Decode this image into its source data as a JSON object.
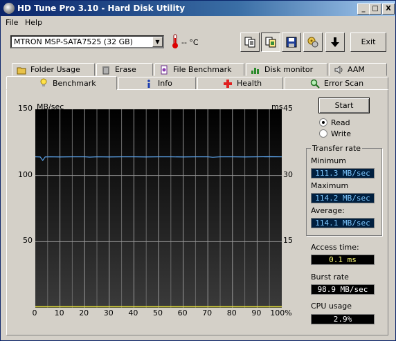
{
  "window": {
    "title": "HD Tune Pro 3.10 - Hard Disk Utility",
    "min": "_",
    "max": "□",
    "close": "X"
  },
  "menu": {
    "file": "File",
    "help": "Help"
  },
  "toolbar": {
    "drive": "MTRON MSP-SATA7525 (32 GB)",
    "temperature": "-- °C",
    "exit": "Exit",
    "icons": [
      "copy-text-icon",
      "copy-screenshot-icon",
      "save-icon",
      "options-icon",
      "download-arrow-icon"
    ]
  },
  "tabs_row1": [
    {
      "label": "Folder Usage",
      "icon": "folder-icon"
    },
    {
      "label": "Erase",
      "icon": "trash-icon"
    },
    {
      "label": "File Benchmark",
      "icon": "file-benchmark-icon"
    },
    {
      "label": "Disk monitor",
      "icon": "disk-monitor-icon"
    },
    {
      "label": "AAM",
      "icon": "speaker-icon"
    }
  ],
  "tabs_row2": [
    {
      "label": "Benchmark",
      "icon": "lightbulb-icon",
      "active": true
    },
    {
      "label": "Info",
      "icon": "info-icon"
    },
    {
      "label": "Health",
      "icon": "health-cross-icon"
    },
    {
      "label": "Error Scan",
      "icon": "magnifier-icon"
    }
  ],
  "controls": {
    "start": "Start",
    "read": "Read",
    "write": "Write",
    "mode_selected": "Read"
  },
  "transfer_rate": {
    "title": "Transfer rate",
    "minimum_label": "Minimum",
    "minimum": "111.3 MB/sec",
    "maximum_label": "Maximum",
    "maximum": "114.2 MB/sec",
    "average_label": "Average:",
    "average": "114.1 MB/sec"
  },
  "stats": {
    "access_label": "Access time:",
    "access": "0.1 ms",
    "burst_label": "Burst rate",
    "burst": "98.9 MB/sec",
    "cpu_label": "CPU usage",
    "cpu": "2.9%"
  },
  "chart_data": {
    "type": "line",
    "ylabel_left": "MB/sec",
    "ylabel_right": "ms",
    "ylim_left": [
      0,
      150
    ],
    "ylim_right": [
      0,
      45
    ],
    "y_ticks_left": [
      "150",
      "100",
      "50"
    ],
    "y_ticks_right": [
      "45",
      "30",
      "15"
    ],
    "x_ticks": [
      "0",
      "10",
      "20",
      "30",
      "40",
      "50",
      "60",
      "70",
      "80",
      "90",
      "100%"
    ],
    "xlim": [
      0,
      100
    ],
    "grid": true,
    "series": [
      {
        "color": "#5aa0e6",
        "x": [
          0,
          2,
          3,
          4,
          6,
          10,
          15,
          20,
          22,
          25,
          30,
          35,
          40,
          45,
          50,
          55,
          60,
          65,
          70,
          72,
          75,
          80,
          85,
          90,
          95,
          100
        ],
        "y": [
          114.1,
          114.0,
          111.3,
          114.0,
          114.1,
          114.0,
          114.1,
          114.1,
          113.9,
          114.1,
          114.0,
          114.1,
          114.1,
          114.0,
          114.1,
          114.1,
          114.0,
          114.1,
          114.1,
          113.8,
          114.1,
          114.1,
          114.0,
          114.1,
          114.2,
          114.1
        ]
      },
      {
        "color": "#e8e23a",
        "x": [
          0,
          25,
          50,
          70,
          75,
          100
        ],
        "y": [
          0.1,
          0.1,
          0.1,
          0.1,
          0.1,
          0.1
        ]
      }
    ]
  }
}
